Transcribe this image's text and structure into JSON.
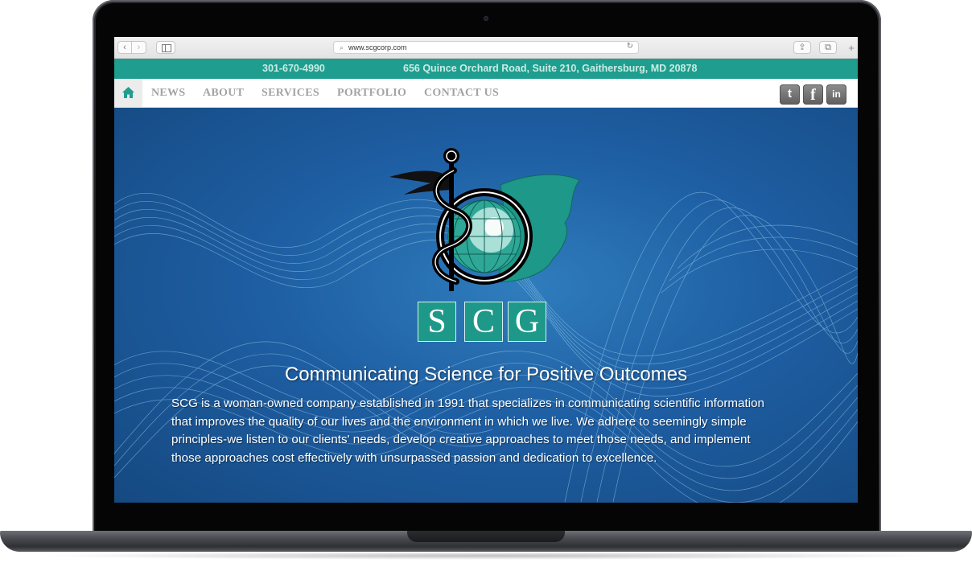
{
  "browser": {
    "url": "www.scgcorp.com",
    "back_glyph": "‹",
    "forward_glyph": "›",
    "search_glyph": "⌕",
    "reload_glyph": "↻",
    "share_glyph": "⇪",
    "tabs_glyph": "⧉",
    "new_tab_glyph": "+"
  },
  "contact": {
    "phone": "301-670-4990",
    "address": "656 Quince Orchard Road, Suite 210, Gaithersburg, MD 20878"
  },
  "nav": {
    "items": [
      "NEWS",
      "ABOUT",
      "SERVICES",
      "PORTFOLIO",
      "CONTACT US"
    ]
  },
  "social": {
    "twitter": "t",
    "facebook": "f",
    "linkedin": "in"
  },
  "logo": {
    "letters": [
      "S",
      "C",
      "G"
    ]
  },
  "hero": {
    "tagline": "Communicating Science for Positive Outcomes",
    "description": "SCG is a woman-owned company established in 1991 that specializes in communicating scientific information that improves the quality of our lives and the environment in which we live. We adhere to seemingly simple principles-we listen to our clients' needs, develop creative approaches to meet those needs, and implement those approaches cost effectively with unsurpassed passion and dedication to excellence."
  },
  "colors": {
    "teal": "#1f9e8f",
    "nav_text": "#a3a3a3",
    "hero_blue": "#1e5ea3"
  },
  "icons": {
    "home": "home-icon",
    "twitter": "twitter-icon",
    "facebook": "facebook-icon",
    "linkedin": "linkedin-icon"
  }
}
